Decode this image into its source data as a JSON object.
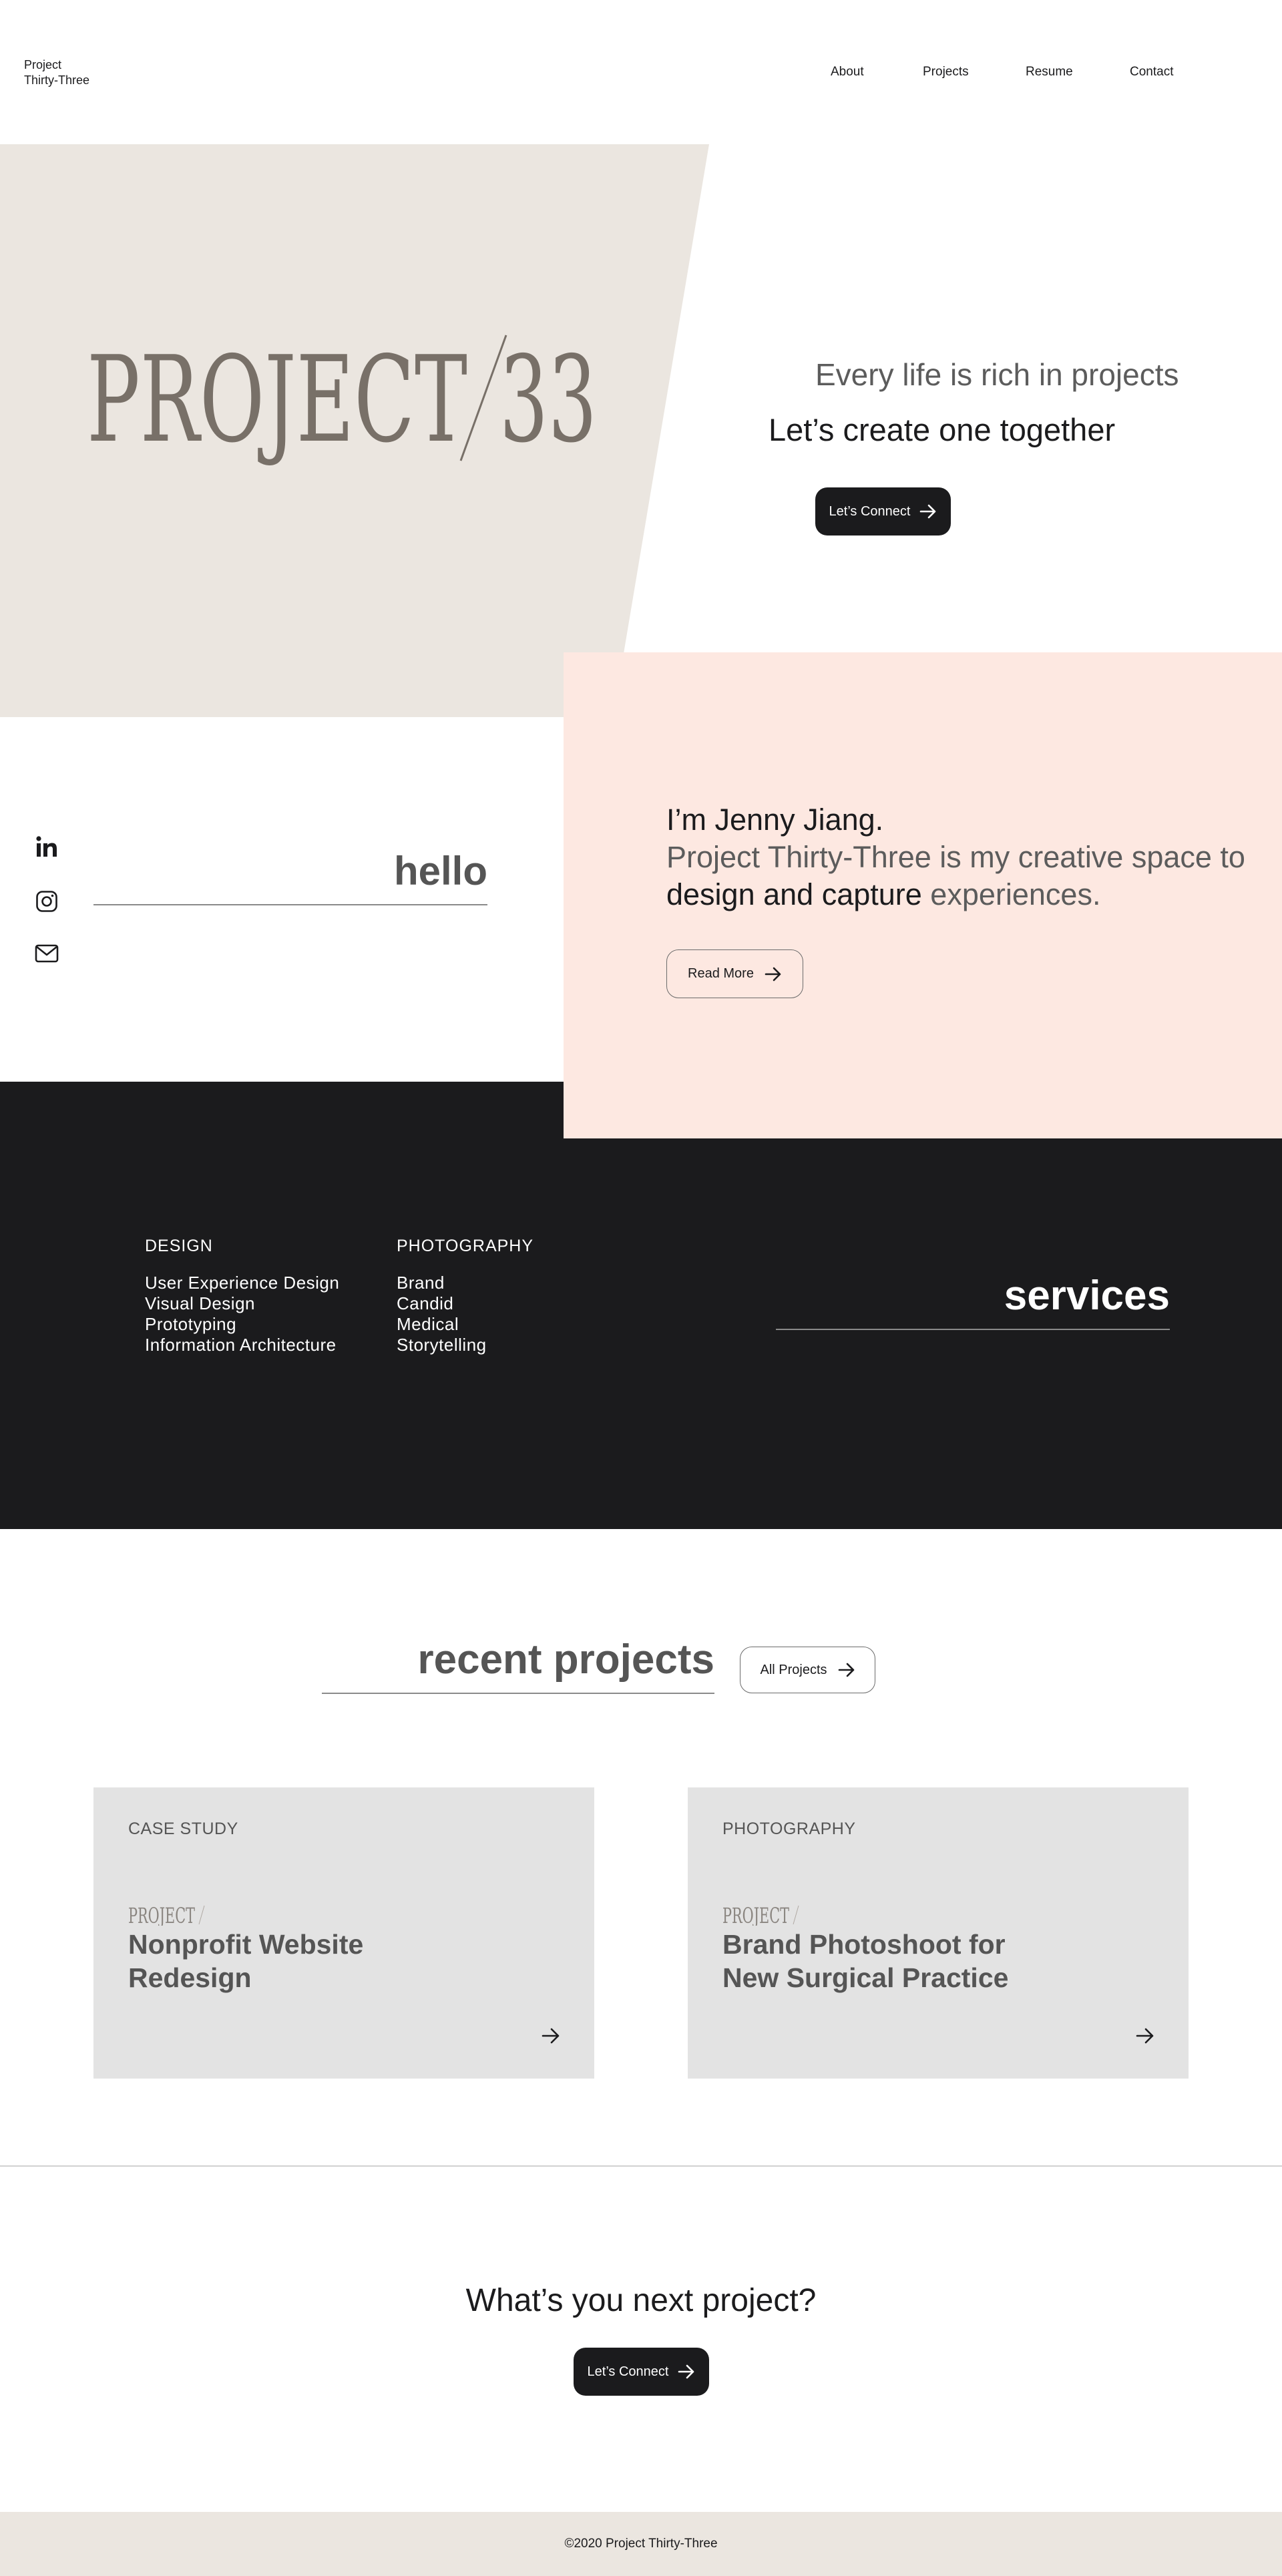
{
  "brand": {
    "line1": "Project",
    "line2": "Thirty-Three"
  },
  "nav": {
    "items": [
      "About",
      "Projects",
      "Resume",
      "Contact"
    ]
  },
  "hero": {
    "logo_left": "PROJECT",
    "logo_slash": "/",
    "logo_right": "33",
    "tagline1": "Every life is rich in projects",
    "tagline2": "Let’s create one together",
    "cta_label": "Let’s Connect"
  },
  "intro": {
    "social": [
      "linkedin-icon",
      "instagram-icon",
      "mail-icon"
    ],
    "hello": "hello",
    "name_line": "I’m Jenny Jiang.",
    "desc_part1": "Project Thirty-Three is my creative space to ",
    "desc_strong": "design and capture",
    "desc_part2": " experiences.",
    "read_more": "Read More"
  },
  "services": {
    "title": "services",
    "design": {
      "heading": "DESIGN",
      "items": [
        "User Experience Design",
        "Visual Design",
        "Prototyping",
        "Information Architecture"
      ]
    },
    "photography": {
      "heading": "PHOTOGRAPHY",
      "items": [
        "Brand",
        "Candid",
        "Medical",
        "Storytelling"
      ]
    }
  },
  "projects": {
    "title": "recent projects",
    "all_label": "All Projects",
    "cards": [
      {
        "category": "CASE STUDY",
        "mini_logo": "PROJECT",
        "title_line1": "Nonprofit Website",
        "title_line2": "Redesign"
      },
      {
        "category": "PHOTOGRAPHY",
        "mini_logo": "PROJECT",
        "title_line1": "Brand Photoshoot for",
        "title_line2": "New Surgical Practice"
      }
    ]
  },
  "cta": {
    "title": "What’s you next project?",
    "button": "Let’s Connect"
  },
  "footer": {
    "copyright": "©2020 Project Thirty-Three"
  },
  "colors": {
    "dark": "#1b1b1d",
    "beige": "#ebe6e0",
    "pink": "#fde8e1",
    "card": "#e3e3e3",
    "logo": "#787068"
  }
}
